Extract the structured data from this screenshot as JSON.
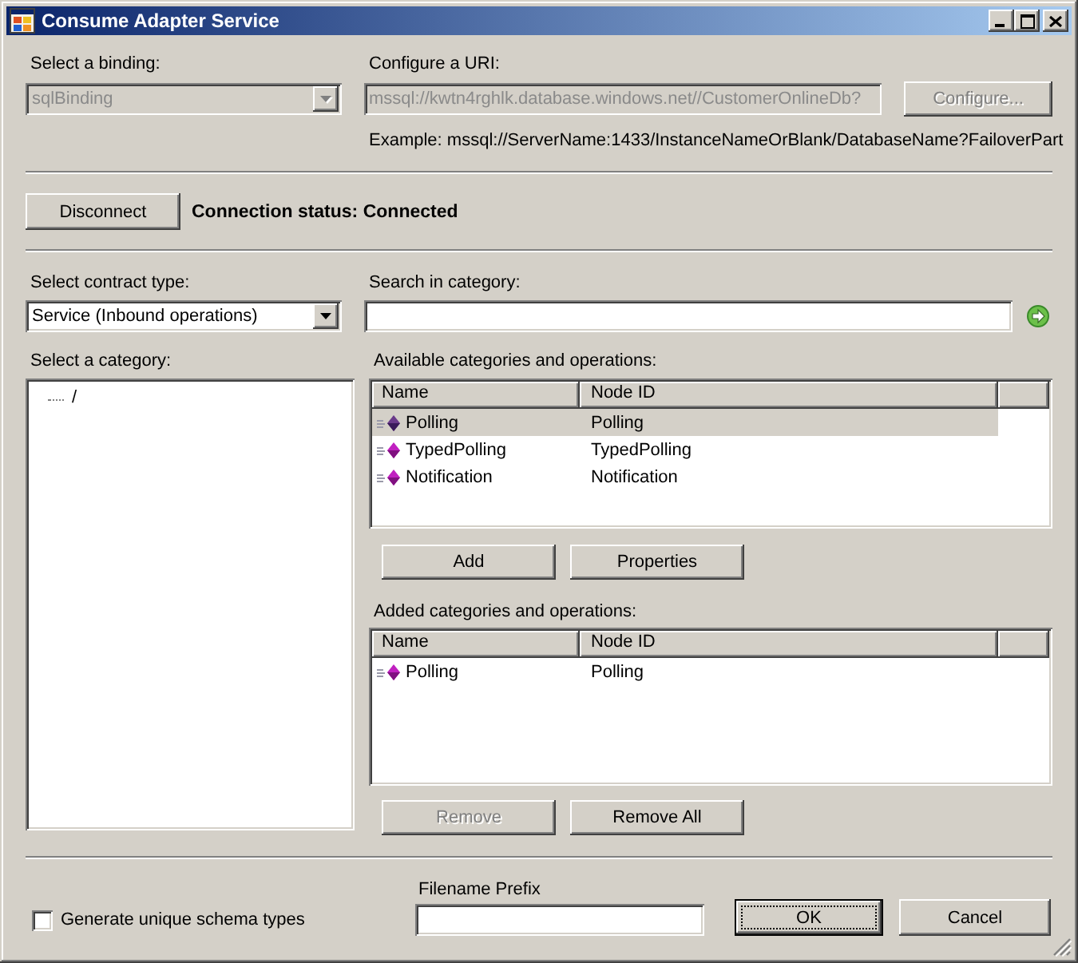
{
  "window": {
    "title": "Consume Adapter Service"
  },
  "binding": {
    "label": "Select a binding:",
    "value": "sqlBinding",
    "disabled": true
  },
  "uri": {
    "label": "Configure a URI:",
    "value": "mssql://kwtn4rghlk.database.windows.net//CustomerOnlineDb?",
    "disabled": true
  },
  "configure_button": {
    "label": "Configure...",
    "disabled": true
  },
  "example": "Example: mssql://ServerName:1433/InstanceNameOrBlank/DatabaseName?FailoverPart",
  "connection": {
    "button": {
      "label": "Disconnect",
      "disabled": false
    },
    "status": "Connection status: Connected"
  },
  "contract_type": {
    "label": "Select contract type:",
    "value": "Service (Inbound operations)",
    "disabled": false
  },
  "search": {
    "label": "Search in category:"
  },
  "category": {
    "label": "Select a category:",
    "tree": [
      {
        "label": "/",
        "selected": false
      }
    ]
  },
  "available": {
    "label": "Available categories and operations:",
    "columns": [
      "Name",
      "Node ID"
    ],
    "rows": [
      {
        "name": "Polling",
        "node_id": "Polling",
        "selected": true
      },
      {
        "name": "TypedPolling",
        "node_id": "TypedPolling",
        "selected": false
      },
      {
        "name": "Notification",
        "node_id": "Notification",
        "selected": false
      }
    ]
  },
  "available_buttons": [
    {
      "label": "Add",
      "disabled": false
    },
    {
      "label": "Properties",
      "disabled": false
    }
  ],
  "added": {
    "label": "Added categories and operations:",
    "columns": [
      "Name",
      "Node ID"
    ],
    "rows": [
      {
        "name": "Polling",
        "node_id": "Polling",
        "selected": false
      }
    ]
  },
  "added_buttons": [
    {
      "label": "Remove",
      "disabled": true
    },
    {
      "label": "Remove All",
      "disabled": false
    }
  ],
  "generate_unique": {
    "label": "Generate unique schema types",
    "checked": false
  },
  "filename_prefix": {
    "label": "Filename Prefix"
  },
  "dialog_buttons": [
    {
      "label": "OK",
      "default": true,
      "disabled": false
    },
    {
      "label": "Cancel",
      "default": false,
      "disabled": false
    }
  ]
}
